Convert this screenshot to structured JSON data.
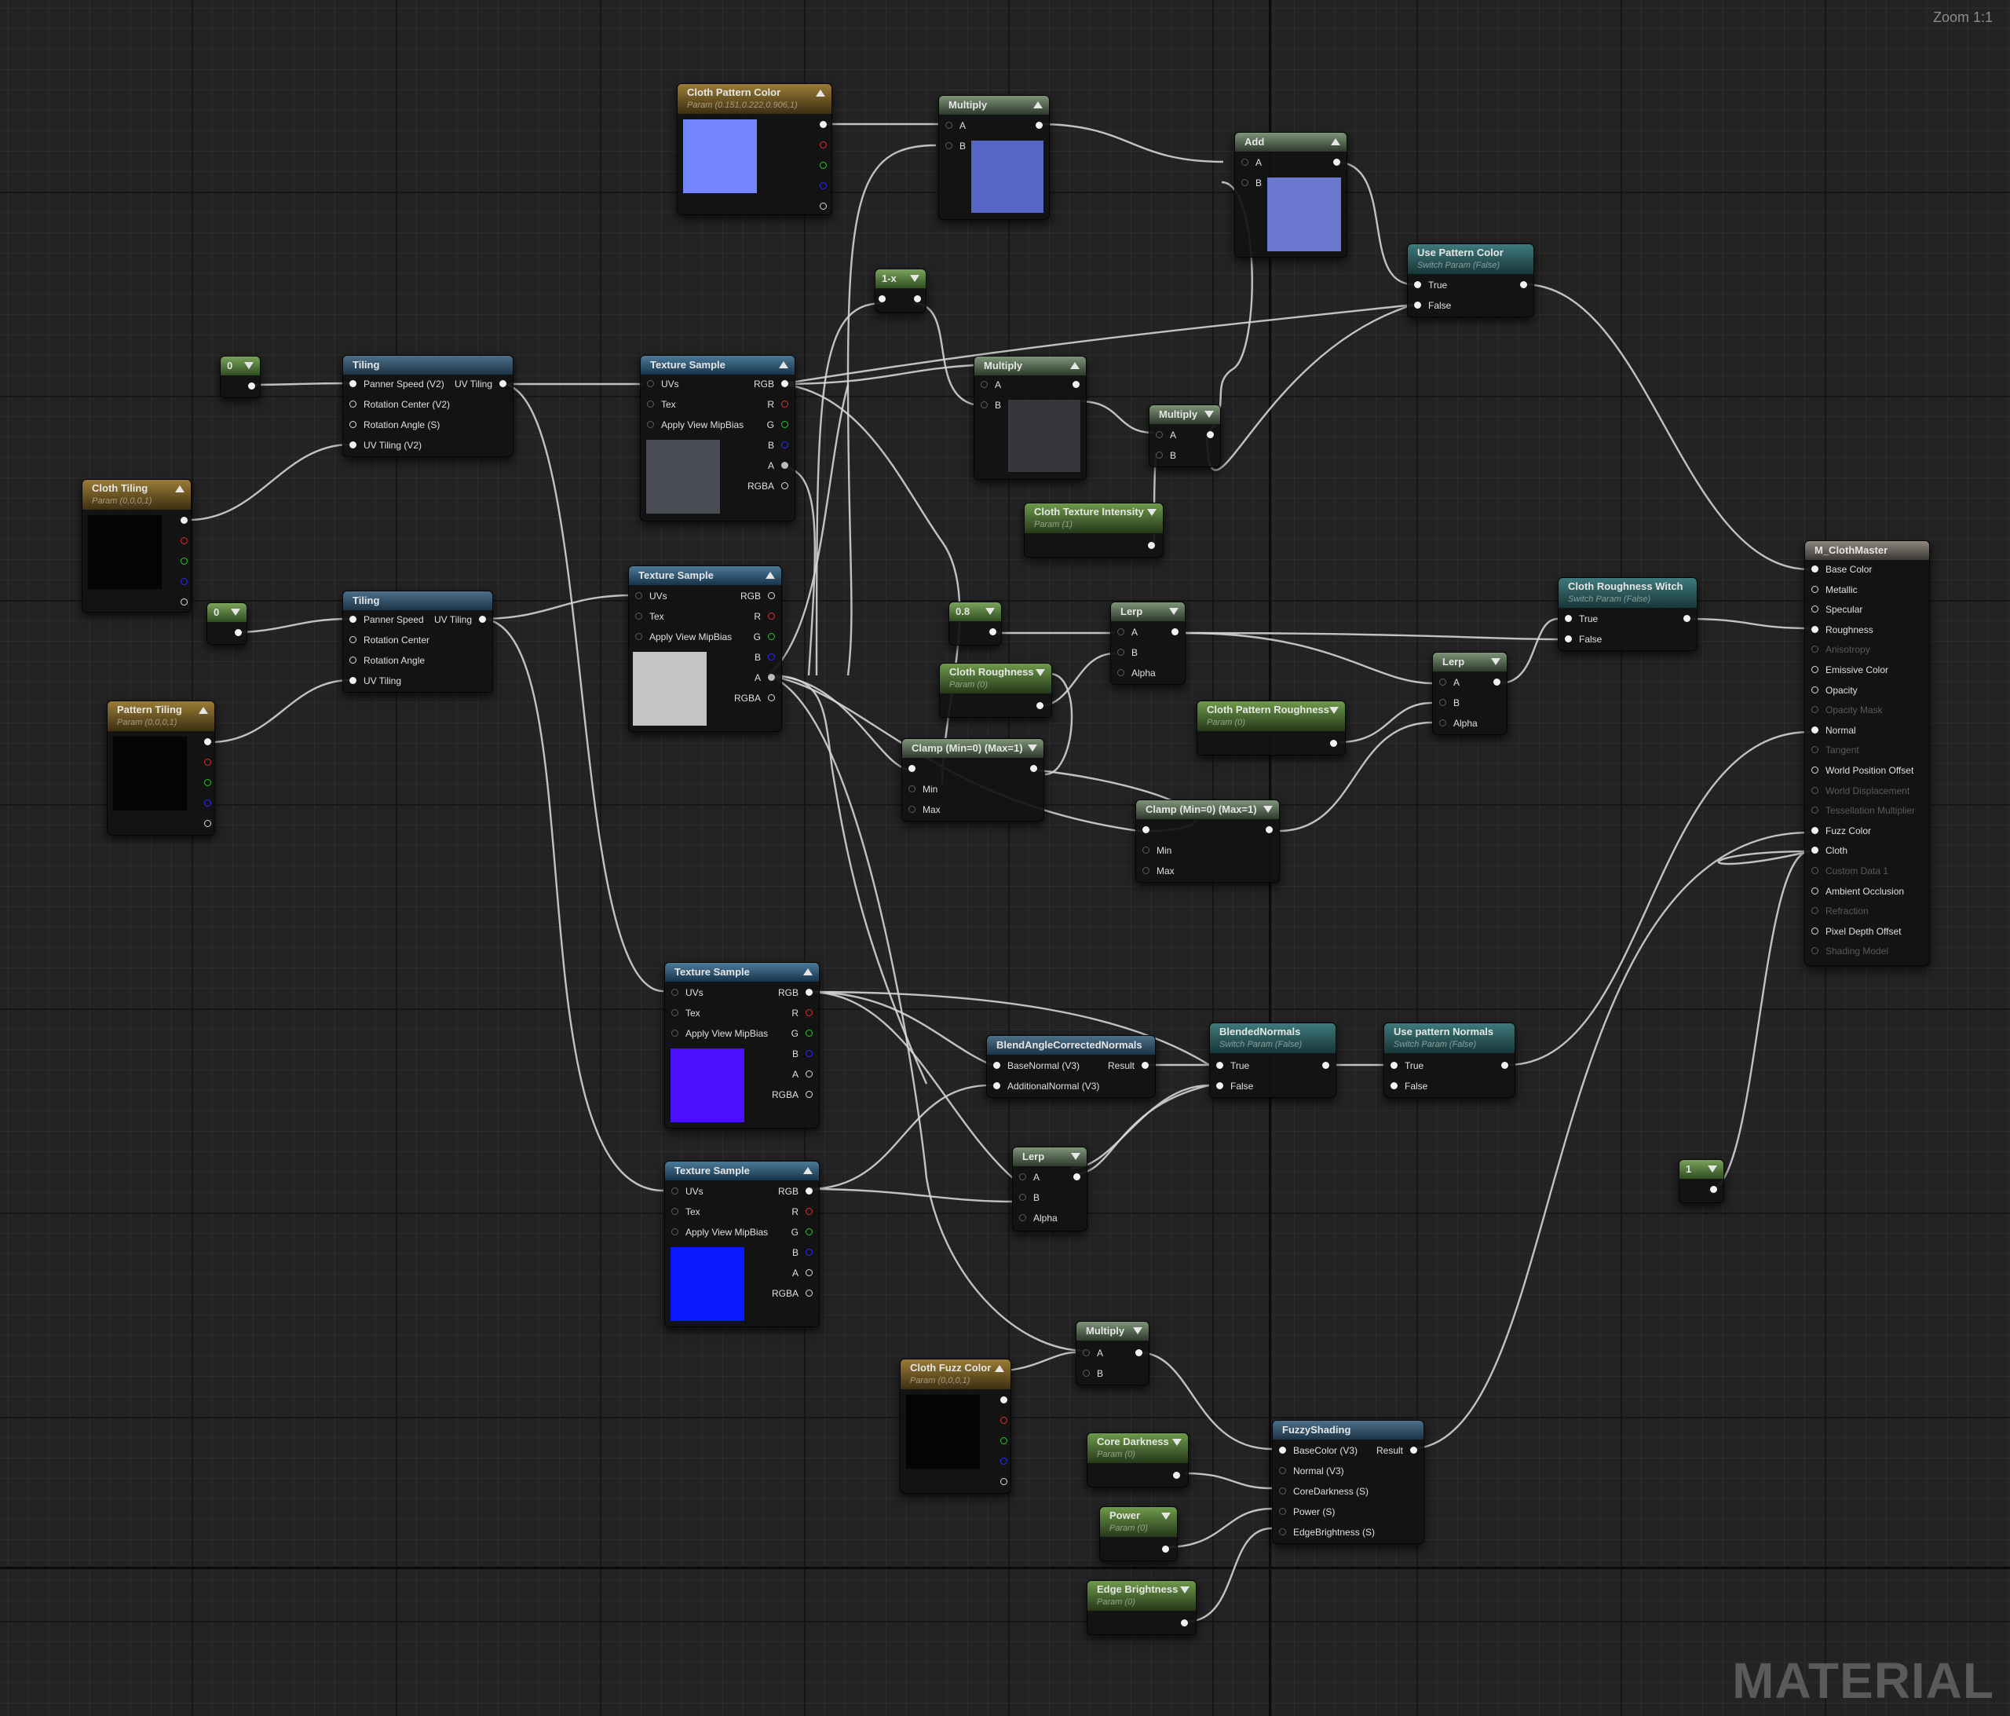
{
  "editor": {
    "zoom_label": "Zoom 1:1",
    "watermark": "MATERIAL"
  },
  "colors": {
    "pin_red": "#e23030",
    "pin_green": "#27cc27",
    "pin_blue": "#2b2bff"
  },
  "nodes": {
    "cloth_pattern_color": {
      "title": "Cloth Pattern Color",
      "subtitle": "Param (0.151,0.222,0.906,1)",
      "swatch": "#7385ff"
    },
    "multiply_1": {
      "title": "Multiply",
      "pins": {
        "a": "A",
        "b": "B"
      },
      "swatch": "#5566c4"
    },
    "add": {
      "title": "Add",
      "pins": {
        "a": "A",
        "b": "B"
      },
      "swatch": "#6a78d0"
    },
    "use_pattern_color": {
      "title": "Use Pattern Color",
      "subtitle": "Switch Param (False)",
      "pins": {
        "true": "True",
        "false": "False"
      }
    },
    "one_minus_x": {
      "title": "1-x"
    },
    "const_0_a": {
      "title": "0"
    },
    "const_0_b": {
      "title": "0"
    },
    "tiling_1": {
      "title": "Tiling",
      "pins": {
        "panner": "Panner Speed (V2)",
        "rot_center": "Rotation Center (V2)",
        "rot_angle": "Rotation Angle (S)",
        "uv_tiling": "UV Tiling (V2)",
        "out": "UV Tiling"
      }
    },
    "tiling_2": {
      "title": "Tiling",
      "pins": {
        "panner": "Panner Speed",
        "rot_center": "Rotation Center",
        "rot_angle": "Rotation Angle",
        "uv_tiling": "UV Tiling",
        "out": "UV Tiling"
      }
    },
    "texture_sample_1": {
      "title": "Texture Sample",
      "swatch": "#4a4c54"
    },
    "texture_sample_2": {
      "title": "Texture Sample",
      "swatch": "#c4c4c4"
    },
    "texture_sample_3": {
      "title": "Texture Sample",
      "swatch": "#4a10ff"
    },
    "texture_sample_4": {
      "title": "Texture Sample",
      "swatch": "#0a1aff"
    },
    "texture_pins": {
      "uvs": "UVs",
      "tex": "Tex",
      "mip": "Apply View MipBias",
      "rgb": "RGB",
      "r": "R",
      "g": "G",
      "b": "B",
      "a": "A",
      "rgba": "RGBA"
    },
    "multiply_2": {
      "title": "Multiply",
      "pins": {
        "a": "A",
        "b": "B"
      },
      "swatch": "#36363c"
    },
    "multiply_3": {
      "title": "Multiply",
      "pins": {
        "a": "A",
        "b": "B"
      }
    },
    "cloth_texture_intensity": {
      "title": "Cloth Texture Intensity",
      "subtitle": "Param (1)"
    },
    "cloth_tiling": {
      "title": "Cloth Tiling",
      "subtitle": "Param (0,0,0,1)",
      "swatch": "#050505"
    },
    "pattern_tiling": {
      "title": "Pattern Tiling",
      "subtitle": "Param (0,0,0,1)",
      "swatch": "#050505"
    },
    "const_08": {
      "title": "0.8"
    },
    "lerp_1": {
      "title": "Lerp",
      "pins": {
        "a": "A",
        "b": "B",
        "alpha": "Alpha"
      }
    },
    "cloth_roughness": {
      "title": "Cloth Roughness",
      "subtitle": "Param (0)"
    },
    "clamp_1": {
      "title": "Clamp (Min=0) (Max=1)",
      "pins": {
        "min": "Min",
        "max": "Max"
      }
    },
    "clamp_2": {
      "title": "Clamp (Min=0) (Max=1)",
      "pins": {
        "min": "Min",
        "max": "Max"
      }
    },
    "cloth_pattern_roughness": {
      "title": "Cloth Pattern Roughness",
      "subtitle": "Param (0)"
    },
    "lerp_2": {
      "title": "Lerp",
      "pins": {
        "a": "A",
        "b": "B",
        "alpha": "Alpha"
      }
    },
    "cloth_roughness_witch": {
      "title": "Cloth Roughness Witch",
      "subtitle": "Switch Param (False)",
      "pins": {
        "true": "True",
        "false": "False"
      }
    },
    "blend_normals_fn": {
      "title": "BlendAngleCorrectedNormals",
      "pins": {
        "base": "BaseNormal (V3)",
        "additional": "AdditionalNormal (V3)",
        "result": "Result"
      }
    },
    "blended_normals": {
      "title": "BlendedNormals",
      "subtitle": "Switch Param (False)",
      "pins": {
        "true": "True",
        "false": "False"
      }
    },
    "use_pattern_normals": {
      "title": "Use pattern Normals",
      "subtitle": "Switch Param (False)",
      "pins": {
        "true": "True",
        "false": "False"
      }
    },
    "lerp_3": {
      "title": "Lerp",
      "pins": {
        "a": "A",
        "b": "B",
        "alpha": "Alpha"
      }
    },
    "const_1": {
      "title": "1"
    },
    "multiply_4": {
      "title": "Multiply",
      "pins": {
        "a": "A",
        "b": "B"
      }
    },
    "cloth_fuzz_color": {
      "title": "Cloth Fuzz Color",
      "subtitle": "Param (0,0,0,1)",
      "swatch": "#050505"
    },
    "fuzzy_shading": {
      "title": "FuzzyShading",
      "pins": {
        "base_color": "BaseColor (V3)",
        "normal": "Normal (V3)",
        "core_darkness": "CoreDarkness (S)",
        "power": "Power (S)",
        "edge_brightness": "EdgeBrightness (S)",
        "result": "Result"
      }
    },
    "core_darkness": {
      "title": "Core Darkness",
      "subtitle": "Param (0)"
    },
    "power": {
      "title": "Power",
      "subtitle": "Param (0)"
    },
    "edge_brightness": {
      "title": "Edge Brightness",
      "subtitle": "Param (0)"
    },
    "m_clothmaster": {
      "title": "M_ClothMaster",
      "pins": [
        "Base Color",
        "Metallic",
        "Specular",
        "Roughness",
        "Anisotropy",
        "Emissive Color",
        "Opacity",
        "Opacity Mask",
        "Normal",
        "Tangent",
        "World Position Offset",
        "World Displacement",
        "Tessellation Multiplier",
        "Fuzz Color",
        "Cloth",
        "Custom Data 1",
        "Ambient Occlusion",
        "Refraction",
        "Pixel Depth Offset",
        "Shading Model"
      ]
    }
  }
}
